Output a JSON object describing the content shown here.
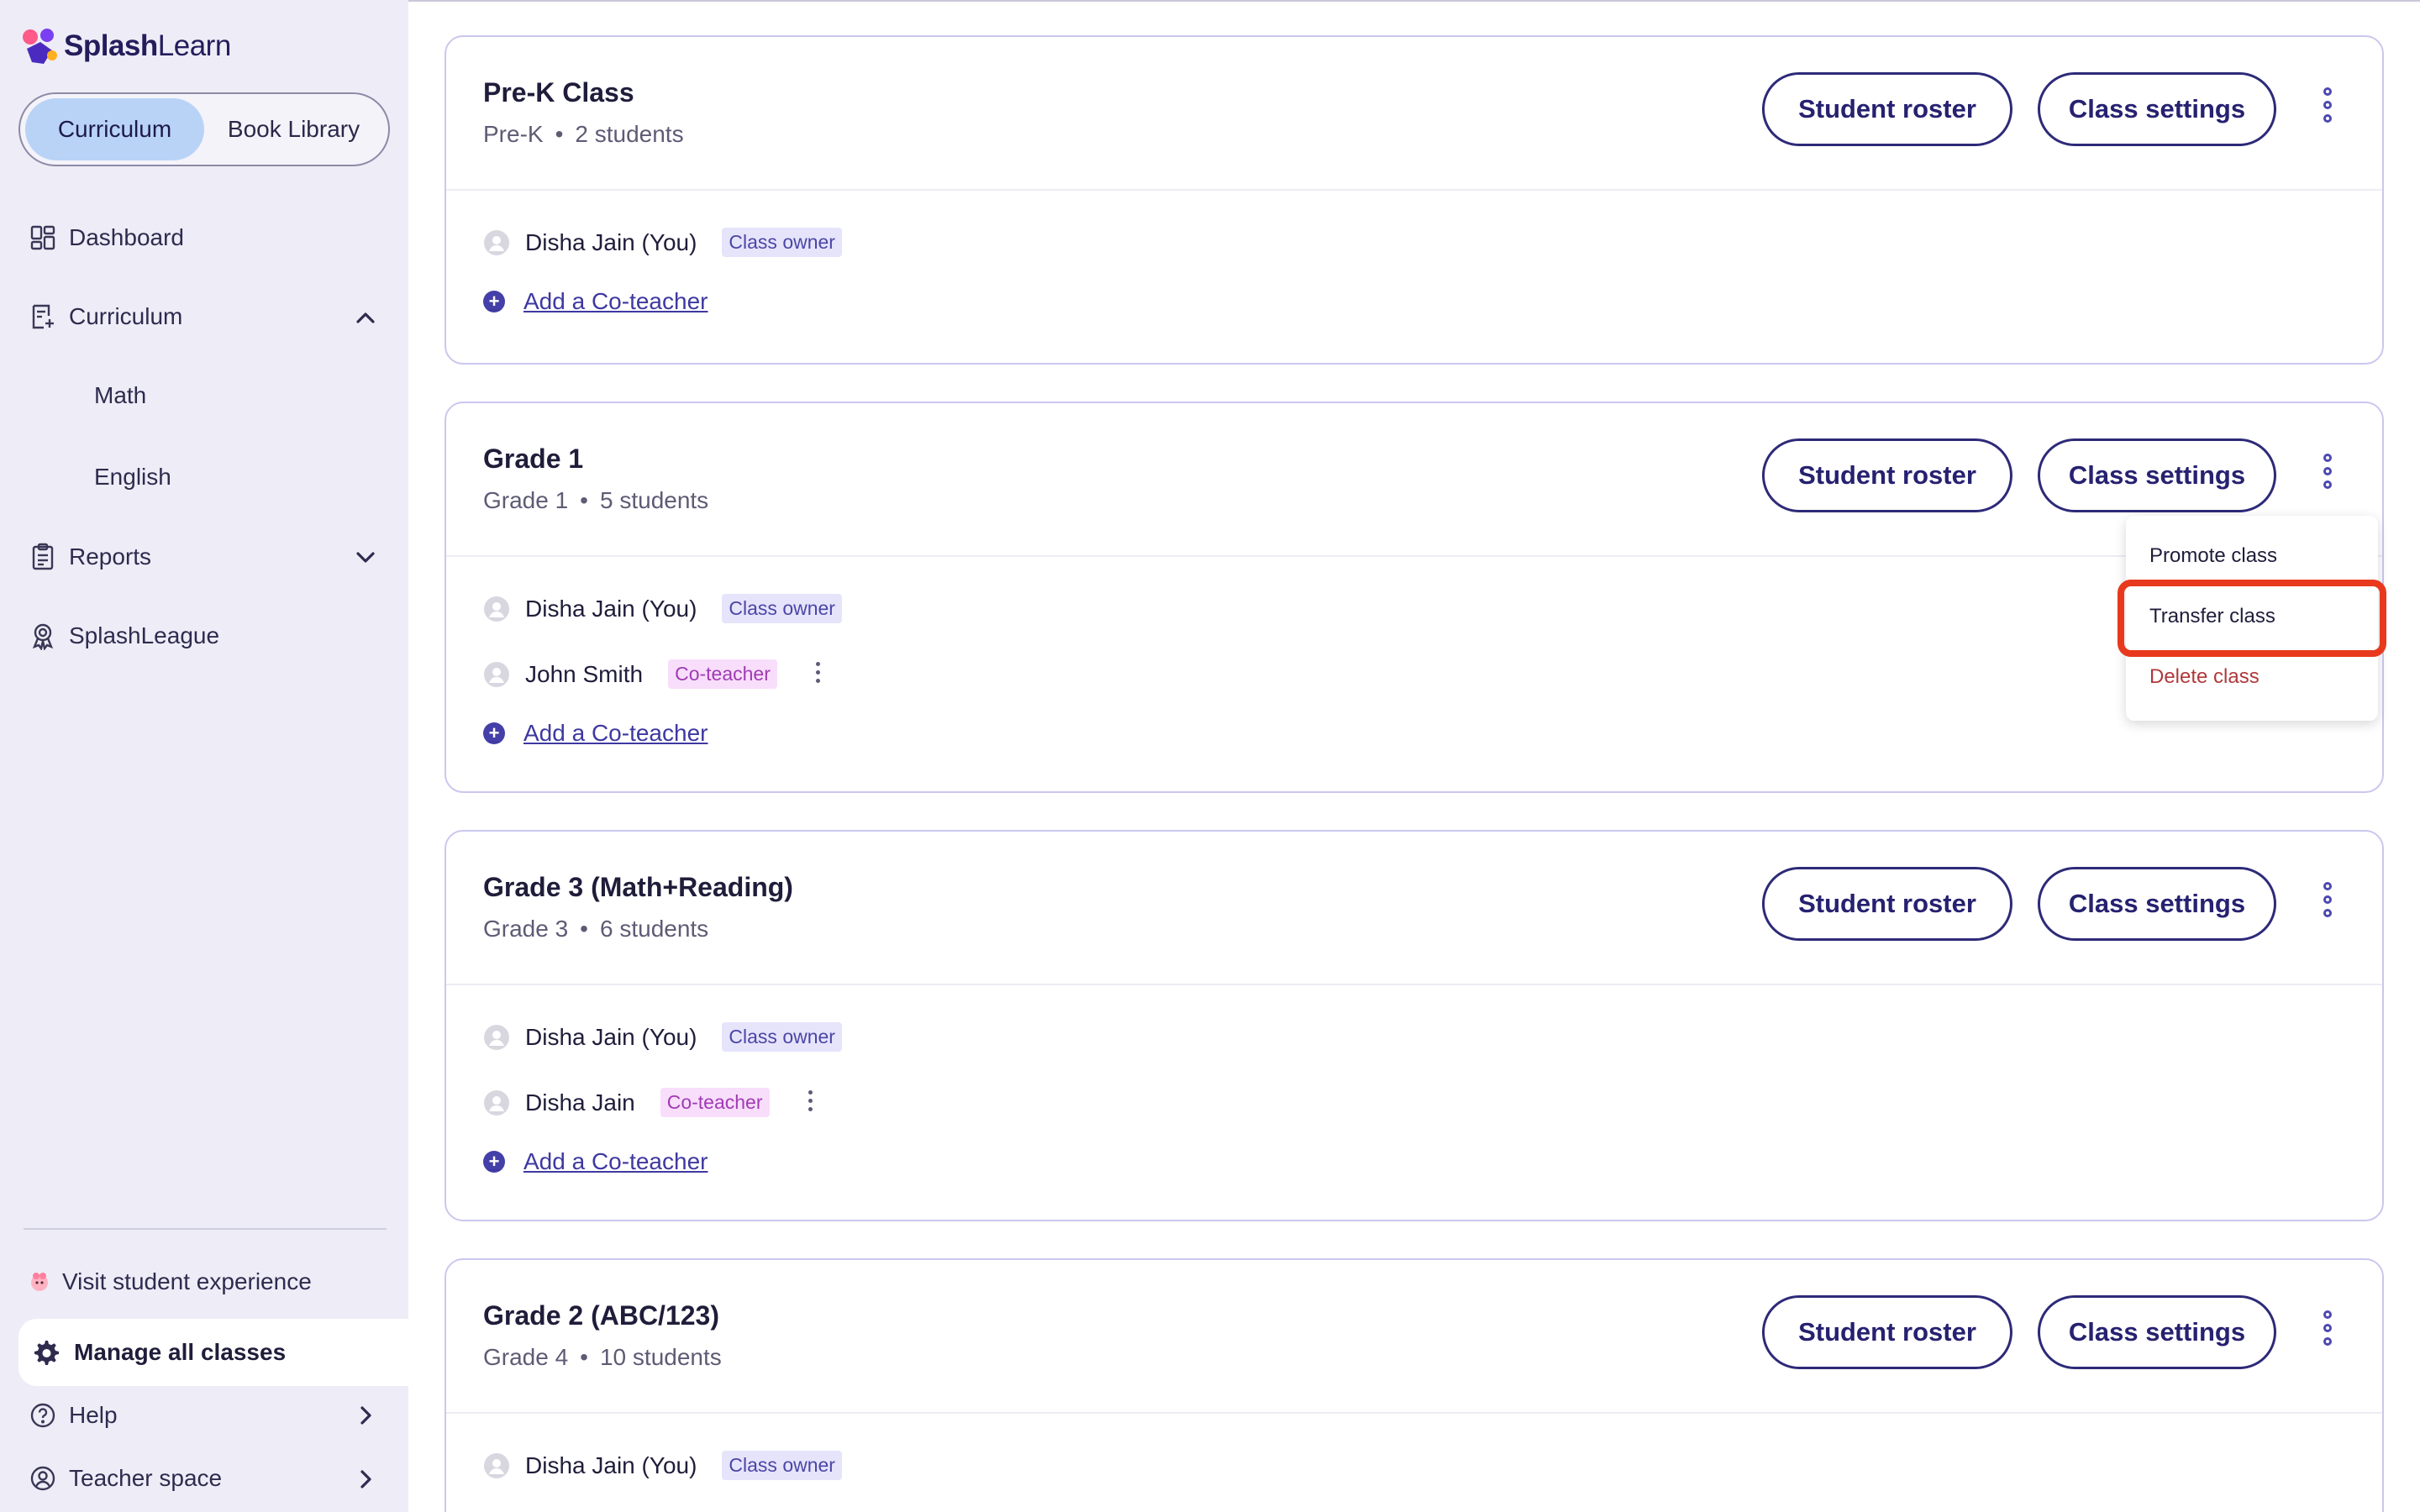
{
  "app": {
    "brand_bold": "Splash",
    "brand_light": "Learn"
  },
  "sidebar": {
    "toggle": {
      "active": "Curriculum",
      "inactive": "Book Library"
    },
    "nav": {
      "dashboard": "Dashboard",
      "curriculum": "Curriculum",
      "math": "Math",
      "english": "English",
      "reports": "Reports",
      "splashleague": "SplashLeague"
    },
    "visit_student_experience": "Visit student experience",
    "manage_all_classes": "Manage all classes",
    "help": "Help",
    "teacher_space": "Teacher space"
  },
  "buttons": {
    "student_roster": "Student roster",
    "class_settings": "Class settings"
  },
  "classes": [
    {
      "title": "Pre-K Class",
      "grade": "Pre-K",
      "students": "2 students",
      "members": [
        {
          "name": "Disha Jain (You)",
          "role": "Class owner"
        }
      ],
      "add_co_teacher": "Add a Co-teacher"
    },
    {
      "title": "Grade 1",
      "grade": "Grade 1",
      "students": "5 students",
      "members": [
        {
          "name": "Disha Jain (You)",
          "role": "Class owner"
        },
        {
          "name": "John Smith",
          "role": "Co-teacher"
        }
      ],
      "add_co_teacher": "Add a Co-teacher"
    },
    {
      "title": "Grade 3 (Math+Reading)",
      "grade": "Grade 3",
      "students": "6 students",
      "members": [
        {
          "name": "Disha Jain (You)",
          "role": "Class owner"
        },
        {
          "name": "Disha Jain",
          "role": "Co-teacher"
        }
      ],
      "add_co_teacher": "Add a Co-teacher"
    },
    {
      "title": "Grade 2 (ABC/123)",
      "grade": "Grade 4",
      "students": "10 students",
      "members": [
        {
          "name": "Disha Jain (You)",
          "role": "Class owner"
        }
      ]
    }
  ],
  "bullet": "•",
  "dropdown": {
    "promote": "Promote class",
    "transfer": "Transfer class",
    "delete": "Delete class"
  },
  "colors": {
    "sidebar_bg": "#eeedf7",
    "accent": "#2d2a78",
    "highlight": "#e8391d",
    "danger": "#b0393c"
  }
}
